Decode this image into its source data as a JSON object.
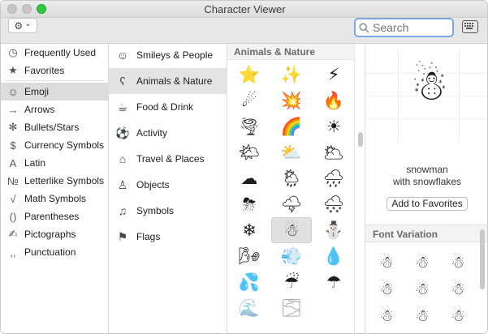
{
  "window": {
    "title": "Character Viewer"
  },
  "toolbar": {
    "gear_icon": "⚙",
    "chevron": "⌄",
    "search_placeholder": "Search"
  },
  "categories": [
    {
      "icon": "clock-icon",
      "glyph": "◷",
      "label": "Frequently Used"
    },
    {
      "icon": "star-icon",
      "glyph": "★",
      "label": "Favorites"
    },
    {
      "icon": "smiley-icon",
      "glyph": "☺",
      "label": "Emoji",
      "selected": true
    },
    {
      "icon": "arrow-icon",
      "glyph": "→",
      "label": "Arrows"
    },
    {
      "icon": "asterisk-icon",
      "glyph": "✻",
      "label": "Bullets/Stars"
    },
    {
      "icon": "dollar-icon",
      "glyph": "$",
      "label": "Currency Symbols"
    },
    {
      "icon": "latin-icon",
      "glyph": "A",
      "label": "Latin"
    },
    {
      "icon": "numero-icon",
      "glyph": "№",
      "label": "Letterlike Symbols"
    },
    {
      "icon": "sqrt-icon",
      "glyph": "√",
      "label": "Math Symbols"
    },
    {
      "icon": "parens-icon",
      "glyph": "()",
      "label": "Parentheses"
    },
    {
      "icon": "pictograph-icon",
      "glyph": "✍",
      "label": "Pictographs"
    },
    {
      "icon": "punctuation-icon",
      "glyph": ",,",
      "label": "Punctuation"
    }
  ],
  "subcategories": [
    {
      "icon": "smiley-icon",
      "glyph": "☺",
      "label": "Smileys & People"
    },
    {
      "icon": "bear-icon",
      "glyph": "ʕ",
      "label": "Animals & Nature",
      "selected": true
    },
    {
      "icon": "food-icon",
      "glyph": "☕",
      "label": "Food & Drink"
    },
    {
      "icon": "ball-icon",
      "glyph": "⚽",
      "label": "Activity"
    },
    {
      "icon": "building-icon",
      "glyph": "⌂",
      "label": "Travel & Places"
    },
    {
      "icon": "bulb-icon",
      "glyph": "♙",
      "label": "Objects"
    },
    {
      "icon": "symbols-icon",
      "glyph": "♫",
      "label": "Symbols"
    },
    {
      "icon": "flag-icon",
      "glyph": "⚑",
      "label": "Flags"
    }
  ],
  "grid": {
    "header": "Animals & Nature",
    "cells": [
      "⭐",
      "✨",
      "⚡",
      "☄",
      "💥",
      "🔥",
      "🌪",
      "🌈",
      "☀",
      "🌤",
      "⛅",
      "🌥",
      "☁",
      "🌦",
      "🌧",
      "⛈",
      "🌩",
      "🌨",
      "❄",
      "☃",
      "⛄",
      "🌬",
      "💨",
      "💧",
      "💦",
      "☔",
      "☂",
      "🌊",
      "🌫"
    ],
    "selected_index": 19
  },
  "preview": {
    "glyph": "☃",
    "name_line1": "snowman",
    "name_line2": "with snowflakes",
    "fav_button": "Add to Favorites"
  },
  "font_variation": {
    "header": "Font Variation",
    "glyphs": [
      "☃",
      "☃",
      "☃",
      "☃",
      "☃",
      "☃",
      "☃",
      "☃",
      "☃"
    ]
  }
}
